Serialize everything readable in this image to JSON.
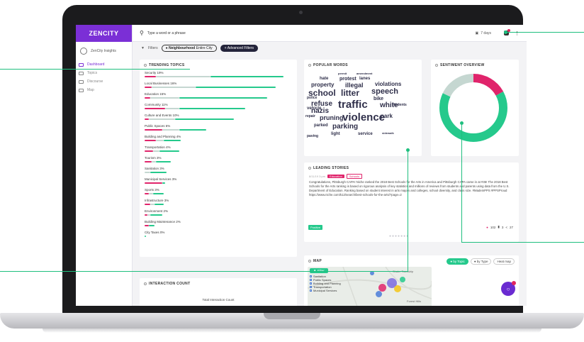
{
  "app": {
    "logo": "ZENCITY",
    "user": "ZenCity Insights"
  },
  "nav": [
    {
      "label": "Dashboard",
      "active": true
    },
    {
      "label": "Topics",
      "active": false
    },
    {
      "label": "Discourse",
      "active": false
    },
    {
      "label": "Map",
      "active": false
    }
  ],
  "search": {
    "placeholder": "Type a word or a phrase"
  },
  "topbar": {
    "date_range": "7 days"
  },
  "filters": {
    "label": "Filters",
    "pill_key": "Neighbourhood",
    "pill_value": "Entire City",
    "advanced": "+ Advanced Filters"
  },
  "trending": {
    "title": "TRENDING TOPICS",
    "items": [
      {
        "label": "Security 19%",
        "neg": 0.08,
        "neu": 0.37,
        "pos": 0.5
      },
      {
        "label": "Local Businesses 16%",
        "neg": 0.05,
        "neu": 0.3,
        "pos": 0.55
      },
      {
        "label": "Education 15%",
        "neg": 0.04,
        "neu": 0.2,
        "pos": 0.6
      },
      {
        "label": "Community 11%",
        "neg": 0.14,
        "neu": 0.1,
        "pos": 0.45
      },
      {
        "label": "Culture and Events 10%",
        "neg": 0.03,
        "neu": 0.18,
        "pos": 0.4
      },
      {
        "label": "Public Spaces 6%",
        "neg": 0.12,
        "neu": 0.12,
        "pos": 0.18
      },
      {
        "label": "Building and Planning 4%",
        "neg": 0.08,
        "neu": 0.05,
        "pos": 0.12
      },
      {
        "label": "Transportation 4%",
        "neg": 0.06,
        "neu": 0.04,
        "pos": 0.14
      },
      {
        "label": "Tourism 3%",
        "neg": 0.05,
        "neu": 0.03,
        "pos": 0.1
      },
      {
        "label": "Sanitation 3%",
        "neg": 0.0,
        "neu": 0.04,
        "pos": 0.11
      },
      {
        "label": "Municipal Services 3%",
        "neg": 0.12,
        "neu": 0.0,
        "pos": 0.02
      },
      {
        "label": "Sports 3%",
        "neg": 0.03,
        "neu": 0.03,
        "pos": 0.07
      },
      {
        "label": "Infrastructure 3%",
        "neg": 0.04,
        "neu": 0.03,
        "pos": 0.06
      },
      {
        "label": "Environment 2%",
        "neg": 0.02,
        "neu": 0.02,
        "pos": 0.08
      },
      {
        "label": "Building Maintenance 2%",
        "neg": 0.03,
        "neu": 0.0,
        "pos": 0.04
      },
      {
        "label": "City Taxes 0%",
        "neg": 0.0,
        "neu": 0.0,
        "pos": 0.01
      }
    ]
  },
  "popular_words": {
    "title": "POPULAR WORDS",
    "words": [
      "permit",
      "amendment",
      "hate",
      "protest",
      "lanes",
      "property",
      "illegal",
      "violations",
      "school",
      "litter",
      "speech",
      "police",
      "bike",
      "refuse",
      "traffic",
      "vehicle",
      "nazis",
      "white",
      "repair",
      "pruning",
      "violence",
      "park",
      "parked",
      "parking",
      "light",
      "service",
      "paving",
      "sidewalk",
      "students"
    ]
  },
  "sentiment": {
    "title": "SENTIMENT OVERVIEW",
    "negative": 0.17,
    "neutral": 0.18,
    "positive": 0.65,
    "colors": {
      "negative": "#e0246b",
      "neutral": "#c5d7d1",
      "positive": "#25c98c"
    }
  },
  "stories": {
    "title": "LEADING STORIES",
    "date": "8/11/19 3:pm",
    "tag1": "Education",
    "tag2": "Schools",
    "text": "Congratulations, Pittsburgh CAPA! Niche ranked the 2018 Best Schools for the Arts in America and Pittsburgh CAPA came in at #35! The 2018 Best Schools for the Arts ranking is based on rigorous analysis of key statistics and millions of reviews from students and parents using data from the U.S. Department of Education. Ranking based on student interest in arts majors and colleges, school diversity, and class size. #MadeinPPS #PPSProud https://www.niche.com/k12/search/best-schools-for-the-arts/?page=2",
    "sentiment": "Positive",
    "likes": "102",
    "comments": "3",
    "shares": "27"
  },
  "map": {
    "title": "MAP",
    "tab_topic": "by Topic",
    "tab_type": "by Type",
    "tab_heat": "Heat map",
    "filter": "Filter",
    "legend": [
      "Sanitation",
      "Public Spaces",
      "Building and Planning",
      "Transportation",
      "Municipal Services"
    ],
    "place1": "Shaler Township",
    "place2": "Forest Hills"
  },
  "interaction": {
    "title": "INTERACTION COUNT",
    "label": "Total Interaction Count"
  }
}
